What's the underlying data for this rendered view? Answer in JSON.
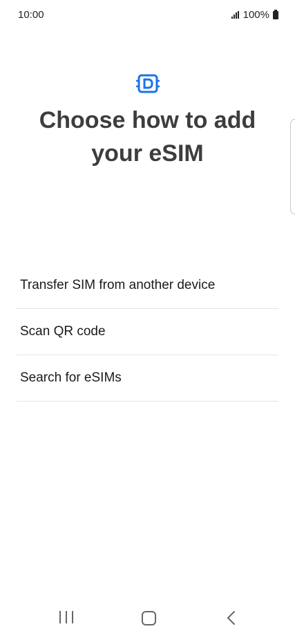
{
  "status_bar": {
    "time": "10:00",
    "battery": "100%"
  },
  "header": {
    "icon": "sim-card-icon",
    "title": "Choose how to add\nyour eSIM",
    "accent_color": "#1a73e8"
  },
  "options": [
    {
      "label": "Transfer SIM from another device"
    },
    {
      "label": "Scan QR code"
    },
    {
      "label": "Search for eSIMs"
    }
  ],
  "nav_bar": {
    "recents": "recents-icon",
    "home": "home-icon",
    "back": "back-icon"
  }
}
